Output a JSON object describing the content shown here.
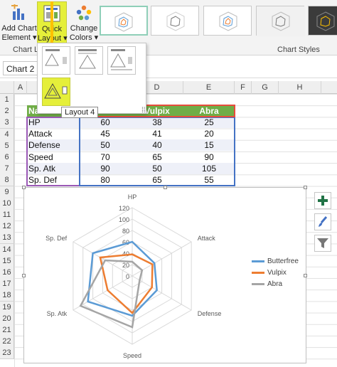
{
  "ribbon": {
    "add_chart_element": [
      "Add Chart",
      "Element ▾"
    ],
    "quick_layout": [
      "Quick",
      "Layout ▾"
    ],
    "change_colors": [
      "Change",
      "Colors ▾"
    ],
    "group_chart_layouts": "Chart La",
    "group_chart_styles": "Chart Styles"
  },
  "name_box": "Chart 2",
  "columns": [
    "A",
    "B",
    "C",
    "D",
    "E",
    "F",
    "G",
    "H"
  ],
  "rows": [
    "1",
    "2",
    "3",
    "4",
    "5",
    "6",
    "7",
    "8",
    "9",
    "10",
    "11",
    "12",
    "13",
    "14",
    "15",
    "16",
    "17",
    "18",
    "19",
    "20",
    "21",
    "22",
    "23"
  ],
  "table": {
    "headers": [
      "Na",
      "",
      "Vulpix",
      "Abra"
    ],
    "rows": [
      {
        "name": "HP",
        "c": "60",
        "d": "38",
        "e": "25"
      },
      {
        "name": "Attack",
        "c": "45",
        "d": "41",
        "e": "20"
      },
      {
        "name": "Defense",
        "c": "50",
        "d": "40",
        "e": "15"
      },
      {
        "name": "Speed",
        "c": "70",
        "d": "65",
        "e": "90"
      },
      {
        "name": "Sp. Atk",
        "c": "90",
        "d": "50",
        "e": "105"
      },
      {
        "name": "Sp. Def",
        "c": "80",
        "d": "65",
        "e": "55"
      }
    ]
  },
  "tooltip": "Layout 4",
  "chart_data": {
    "type": "radar",
    "categories": [
      "HP",
      "Attack",
      "Defense",
      "Speed",
      "Sp. Atk",
      "Sp. Def"
    ],
    "series": [
      {
        "name": "Butterfree",
        "values": [
          60,
          45,
          50,
          70,
          90,
          80
        ],
        "color": "#5b9bd5"
      },
      {
        "name": "Vulpix",
        "values": [
          38,
          41,
          40,
          65,
          50,
          65
        ],
        "color": "#ed7d31"
      },
      {
        "name": "Abra",
        "values": [
          25,
          20,
          15,
          90,
          105,
          55
        ],
        "color": "#a5a5a5"
      }
    ],
    "ticks": [
      "0",
      "20",
      "40",
      "60",
      "80",
      "100",
      "120"
    ],
    "rmax": 120,
    "legend_position": "right"
  },
  "icons": {
    "add_chart_element": "chart-add-icon",
    "quick_layout": "layout-icon",
    "change_colors": "palette-icon",
    "chart_elements": "plus-icon",
    "chart_styles": "brush-icon",
    "chart_filters": "filter-icon"
  },
  "colors": {
    "accent_highlight": "#e5ef3a",
    "table_header": "#70ad47",
    "arrow": "#ffc000"
  }
}
